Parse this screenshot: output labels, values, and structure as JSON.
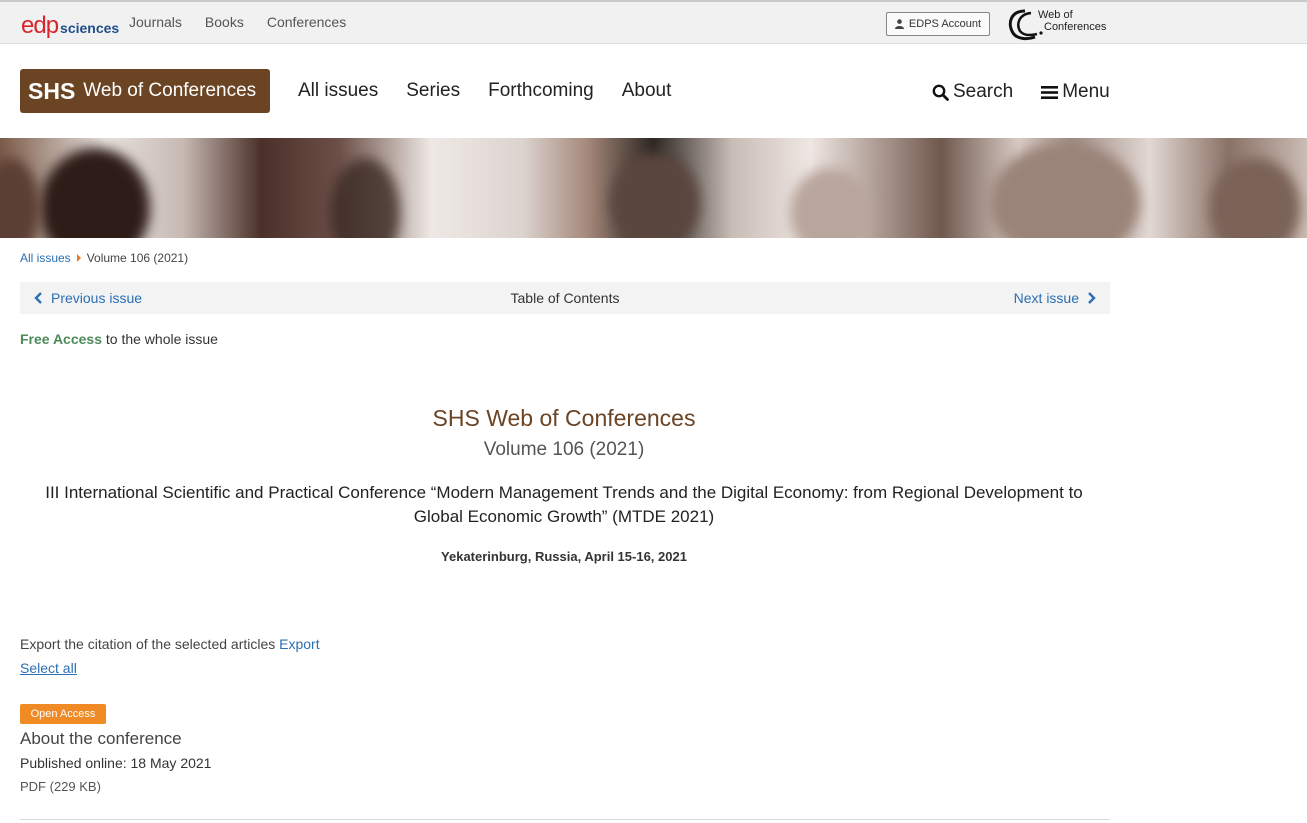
{
  "topbar": {
    "logo_edp": "edp",
    "logo_sciences": "sciences",
    "links": [
      "Journals",
      "Books",
      "Conferences"
    ],
    "account_button": "EDPS Account",
    "wofc_logo_line1": "Web of",
    "wofc_logo_line2": "Conferences"
  },
  "header": {
    "brand_short": "SHS",
    "brand_long": "Web of Conferences",
    "nav": [
      "All issues",
      "Series",
      "Forthcoming",
      "About"
    ],
    "search_label": "Search",
    "menu_label": "Menu"
  },
  "breadcrumb": {
    "root": "All issues",
    "current": "Volume 106 (2021)"
  },
  "issue_nav": {
    "previous": "Previous issue",
    "toc": "Table of Contents",
    "next": "Next issue"
  },
  "free_access": {
    "label": "Free Access",
    "rest": "to the whole issue"
  },
  "issue": {
    "journal": "SHS Web of Conferences",
    "volume": "Volume 106 (2021)",
    "conference": "III International Scientific and Practical Conference “Modern Management Trends and the Digital Economy: from Regional Development to Global Economic Growth” (MTDE 2021)",
    "location": "Yekaterinburg, Russia, April 15-16, 2021"
  },
  "export": {
    "text": "Export the citation of the selected articles",
    "link": "Export",
    "select_all": "Select all"
  },
  "article": {
    "badge": "Open Access",
    "title": "About the conference",
    "published": "Published online: 18 May 2021",
    "pdf": "PDF (229 KB)"
  },
  "colors": {
    "brand": "#6b4424",
    "link": "#2a6fb3",
    "open_access": "#f08a24",
    "free_access": "#4e8a5a"
  }
}
